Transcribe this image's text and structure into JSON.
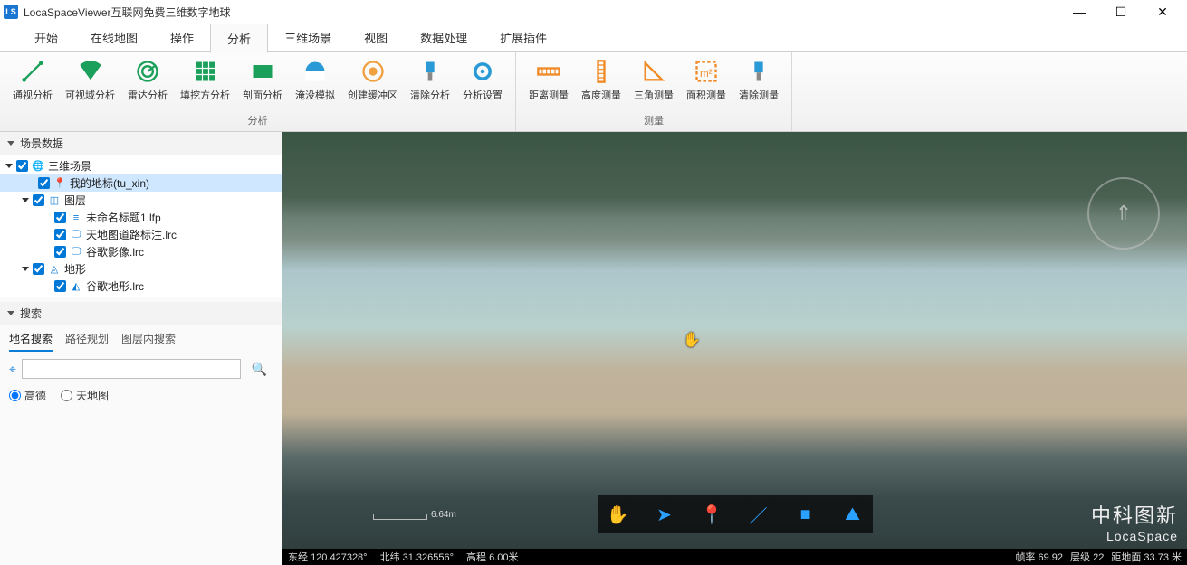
{
  "window": {
    "title": "LocaSpaceViewer互联网免费三维数字地球",
    "icon_text": "LS"
  },
  "menus": [
    "开始",
    "在线地图",
    "操作",
    "分析",
    "三维场景",
    "视图",
    "数据处理",
    "扩展插件"
  ],
  "active_menu_index": 3,
  "ribbon": {
    "groups": [
      {
        "label": "分析",
        "buttons": [
          {
            "name": "analysis-sight",
            "label": "通视分析",
            "icon": "line"
          },
          {
            "name": "analysis-visibility",
            "label": "可视域分析",
            "icon": "fan"
          },
          {
            "name": "analysis-radar",
            "label": "雷达分析",
            "icon": "radar"
          },
          {
            "name": "analysis-cutfill",
            "label": "填挖方分析",
            "icon": "grid"
          },
          {
            "name": "analysis-section",
            "label": "剖面分析",
            "icon": "rect"
          },
          {
            "name": "analysis-flood",
            "label": "淹没模拟",
            "icon": "circle"
          },
          {
            "name": "analysis-buffer",
            "label": "创建缓冲区",
            "icon": "dot"
          },
          {
            "name": "analysis-clear",
            "label": "清除分析",
            "icon": "brush"
          },
          {
            "name": "analysis-settings",
            "label": "分析设置",
            "icon": "gear"
          }
        ]
      },
      {
        "label": "测量",
        "buttons": [
          {
            "name": "measure-distance",
            "label": "距离测量",
            "icon": "ruler"
          },
          {
            "name": "measure-height",
            "label": "高度测量",
            "icon": "vruler"
          },
          {
            "name": "measure-triangle",
            "label": "三角测量",
            "icon": "tri"
          },
          {
            "name": "measure-area",
            "label": "面积测量",
            "icon": "m2"
          },
          {
            "name": "measure-clear",
            "label": "清除测量",
            "icon": "brush"
          }
        ]
      }
    ]
  },
  "sidebar": {
    "scene_panel_title": "场景数据",
    "tree": [
      {
        "depth": 0,
        "tri": true,
        "check": true,
        "icon": "globe",
        "label": "三维场景",
        "name": "node-scene"
      },
      {
        "depth": 1,
        "tri": false,
        "check": true,
        "icon": "pin",
        "label": "我的地标(tu_xin)",
        "selected": true,
        "name": "node-my-landmark"
      },
      {
        "depth": 1,
        "tri": true,
        "check": true,
        "icon": "layers",
        "label": "图层",
        "name": "node-layers"
      },
      {
        "depth": 2,
        "tri": false,
        "check": true,
        "icon": "file",
        "label": "未命名标题1.lfp",
        "name": "node-file-lfp"
      },
      {
        "depth": 2,
        "tri": false,
        "check": true,
        "icon": "monitor",
        "label": "天地图道路标注.lrc",
        "name": "node-tianditu-road"
      },
      {
        "depth": 2,
        "tri": false,
        "check": true,
        "icon": "monitor",
        "label": "谷歌影像.lrc",
        "name": "node-google-image"
      },
      {
        "depth": 1,
        "tri": true,
        "check": true,
        "icon": "terrain",
        "label": "地形",
        "name": "node-terrain"
      },
      {
        "depth": 2,
        "tri": false,
        "check": true,
        "icon": "terrain2",
        "label": "谷歌地形.lrc",
        "name": "node-google-terrain"
      }
    ],
    "search_panel_title": "搜索",
    "search_tabs": [
      "地名搜索",
      "路径规划",
      "图层内搜索"
    ],
    "search_active_tab": 0,
    "search_placeholder": "",
    "radios": [
      "高德",
      "天地图"
    ],
    "radio_selected": 0
  },
  "viewport": {
    "scale_label": "6.64m",
    "dock_tools": [
      {
        "name": "tool-pan",
        "glyph": "✋"
      },
      {
        "name": "tool-select",
        "glyph": "➤"
      },
      {
        "name": "tool-marker",
        "glyph": "📍"
      },
      {
        "name": "tool-line",
        "glyph": "／"
      },
      {
        "name": "tool-rect",
        "glyph": "■"
      },
      {
        "name": "tool-3d",
        "glyph": "⛰"
      }
    ],
    "brand_cn": "中科图新",
    "brand_en": "LocaSpace"
  },
  "statusbar": {
    "lon_label": "东经",
    "lon": "120.427328°",
    "lat_label": "北纬",
    "lat": "31.326556°",
    "elev_label": "高程",
    "elev": "6.00米",
    "fps_label": "帧率",
    "fps": "69.92",
    "level_label": "层级",
    "level": "22",
    "ground_label": "距地面",
    "ground": "33.73 米"
  }
}
